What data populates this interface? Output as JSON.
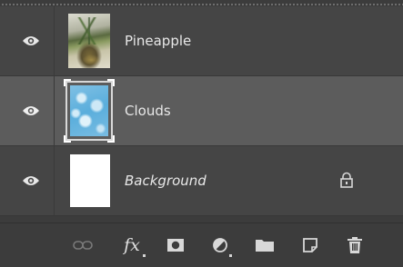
{
  "layers": [
    {
      "name": "Pineapple",
      "visible": true,
      "selected": false,
      "locked": false,
      "thumbnail": "pineapple-photo"
    },
    {
      "name": "Clouds",
      "visible": true,
      "selected": true,
      "locked": false,
      "thumbnail": "clouds-pattern"
    },
    {
      "name": "Background",
      "visible": true,
      "selected": false,
      "locked": true,
      "thumbnail": "white-fill"
    }
  ],
  "toolbar": {
    "fx_label": "fx",
    "icons": [
      "link-icon",
      "fx-icon",
      "mask-icon",
      "adjustment-icon",
      "folder-icon",
      "new-layer-icon",
      "trash-icon"
    ]
  },
  "colors": {
    "panel_bg": "#454545",
    "selected_row": "#5c5c5c",
    "toolbar_bg": "#3c3c3c",
    "text": "#e8e8e8"
  }
}
